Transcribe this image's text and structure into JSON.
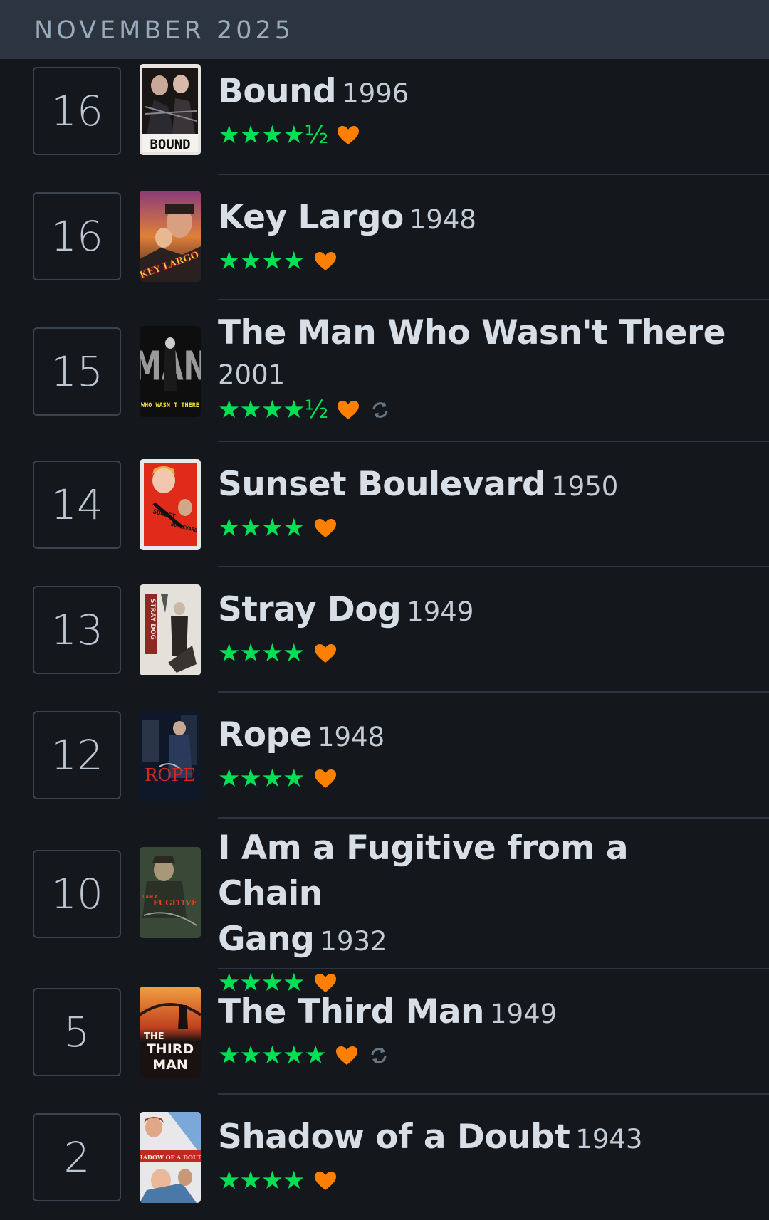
{
  "header": {
    "title": "NOVEMBER 2025"
  },
  "colors": {
    "star": "#00e054",
    "heart": "#ff8000",
    "rewatch": "#678"
  },
  "entries": [
    {
      "day": "16",
      "title": "Bound",
      "year": "1996",
      "stars": "★★★★½",
      "liked": true,
      "rewatch": false,
      "poster": "poster-bound"
    },
    {
      "day": "16",
      "title": "Key Largo",
      "year": "1948",
      "stars": "★★★★",
      "liked": true,
      "rewatch": false,
      "poster": "poster-key-largo"
    },
    {
      "day": "15",
      "title": "The Man Who Wasn't There",
      "year": "2001",
      "stars": "★★★★½",
      "liked": true,
      "rewatch": true,
      "poster": "poster-man-who-wasnt-there"
    },
    {
      "day": "14",
      "title": "Sunset Boulevard",
      "year": "1950",
      "stars": "★★★★",
      "liked": true,
      "rewatch": false,
      "poster": "poster-sunset-boulevard"
    },
    {
      "day": "13",
      "title": "Stray Dog",
      "year": "1949",
      "stars": "★★★★",
      "liked": true,
      "rewatch": false,
      "poster": "poster-stray-dog"
    },
    {
      "day": "12",
      "title": "Rope",
      "year": "1948",
      "stars": "★★★★",
      "liked": true,
      "rewatch": false,
      "poster": "poster-rope"
    },
    {
      "day": "10",
      "title_line1": "I Am a Fugitive from a Chain",
      "title_line2": "Gang",
      "year": "1932",
      "stars": "★★★★",
      "liked": true,
      "rewatch": false,
      "poster": "poster-fugitive"
    },
    {
      "day": "5",
      "title": "The Third Man",
      "year": "1949",
      "stars": "★★★★★",
      "liked": true,
      "rewatch": true,
      "poster": "poster-third-man"
    },
    {
      "day": "2",
      "title": "Shadow of a Doubt",
      "year": "1943",
      "stars": "★★★★",
      "liked": true,
      "rewatch": false,
      "poster": "poster-shadow-of-a-doubt"
    }
  ],
  "poster_text": {
    "bound": "BOUND",
    "key_largo": "KEY LARGO",
    "man_who": "WHO WASN'T THERE",
    "man_big": "MAN",
    "sunset_1": "SUNSET",
    "sunset_2": "BOULEVARD",
    "stray_dog": "STRAY DOG",
    "rope": "ROPE",
    "fugitive_1": "I AM A",
    "fugitive_2": "FUGITIVE",
    "third_1": "THE",
    "third_2": "THIRD",
    "third_3": "MAN",
    "shadow": "SHADOW OF A DOUBT"
  }
}
